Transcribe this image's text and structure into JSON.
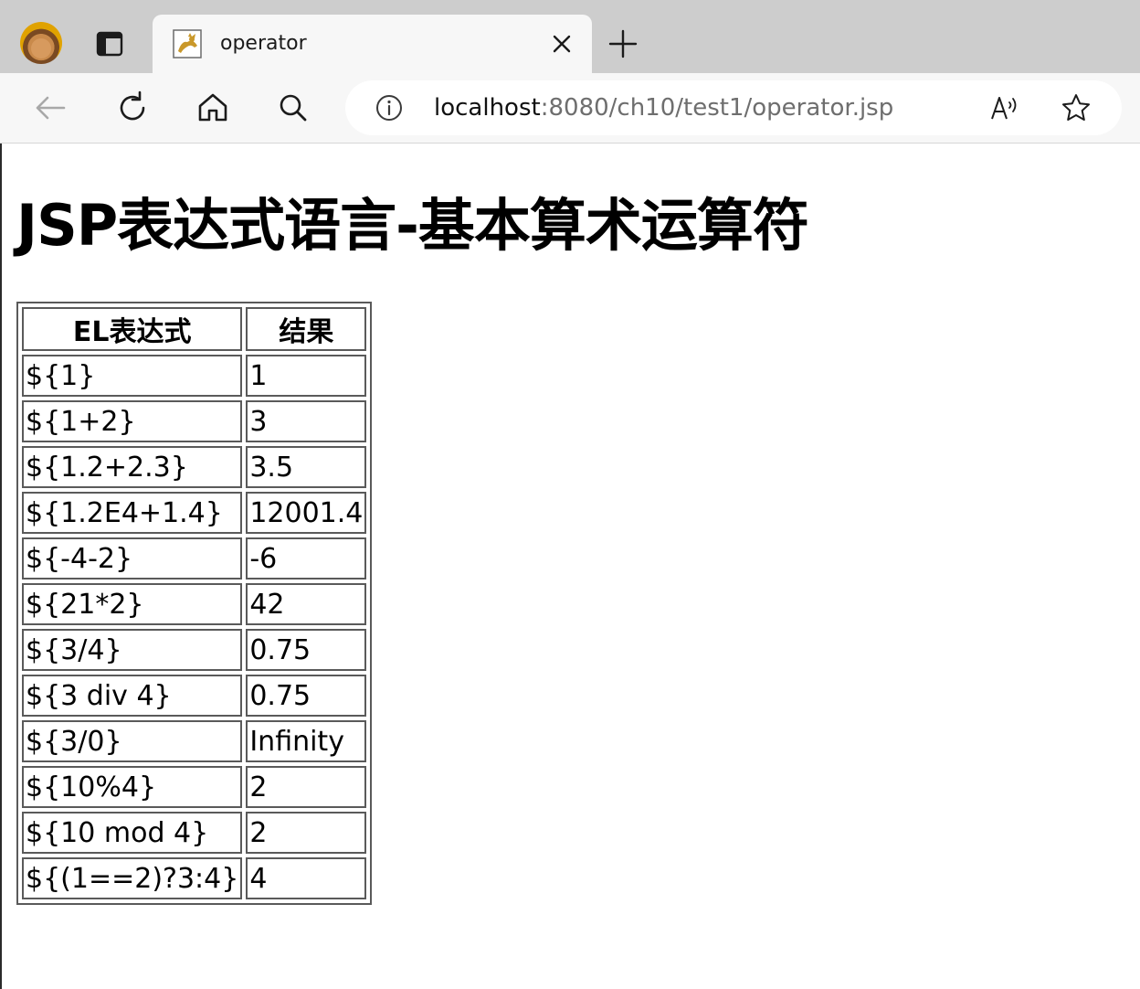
{
  "browser": {
    "tab": {
      "title": "operator",
      "favicon": "tomcat-icon"
    },
    "toolbar": {
      "back": "back-arrow-icon",
      "refresh": "refresh-icon",
      "home": "home-icon",
      "search": "search-icon"
    },
    "address": {
      "host": "localhost",
      "path": ":8080/ch10/test1/operator.jsp"
    }
  },
  "page": {
    "title": "JSP表达式语言-基本算术运算符",
    "table": {
      "headers": [
        "EL表达式",
        "结果"
      ],
      "rows": [
        {
          "expr": "${1}",
          "result": "1"
        },
        {
          "expr": "${1+2}",
          "result": "3"
        },
        {
          "expr": "${1.2+2.3}",
          "result": "3.5"
        },
        {
          "expr": "${1.2E4+1.4}",
          "result": "12001.4"
        },
        {
          "expr": "${-4-2}",
          "result": "-6"
        },
        {
          "expr": "${21*2}",
          "result": "42"
        },
        {
          "expr": "${3/4}",
          "result": "0.75"
        },
        {
          "expr": "${3 div 4}",
          "result": "0.75"
        },
        {
          "expr": "${3/0}",
          "result": "Infinity"
        },
        {
          "expr": "${10%4}",
          "result": "2"
        },
        {
          "expr": "${10 mod 4}",
          "result": "2"
        },
        {
          "expr": "${(1==2)?3:4}",
          "result": "4"
        }
      ]
    }
  }
}
